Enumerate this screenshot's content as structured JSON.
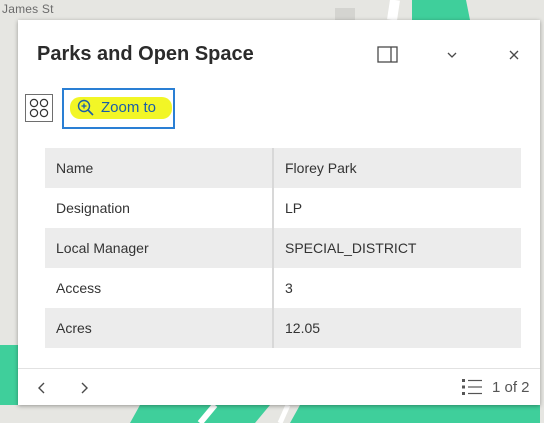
{
  "map": {
    "street_label": "James St",
    "colors": {
      "land": "#e6e6e2",
      "park": "#3fcf9b",
      "road": "#ffffff"
    }
  },
  "popup": {
    "title": "Parks and Open Space",
    "header_buttons": {
      "dock_icon": "dock-panel-icon",
      "collapse_icon": "chevron-down-icon",
      "close_icon": "close-icon"
    },
    "actions": {
      "features_icon": "grid-circles-icon",
      "zoom_label": "Zoom to",
      "zoom_icon": "zoom-in-icon",
      "highlight_color": "#f1f51a"
    },
    "fields": [
      {
        "key": "Name",
        "value": "Florey Park"
      },
      {
        "key": "Designation",
        "value": "LP"
      },
      {
        "key": "Local Manager",
        "value": "SPECIAL_DISTRICT"
      },
      {
        "key": "Access",
        "value": "3"
      },
      {
        "key": "Acres",
        "value": "12.05"
      }
    ],
    "footer": {
      "prev_icon": "chevron-left-icon",
      "next_icon": "chevron-right-icon",
      "list_icon": "list-icon",
      "counter": "1 of 2"
    }
  }
}
